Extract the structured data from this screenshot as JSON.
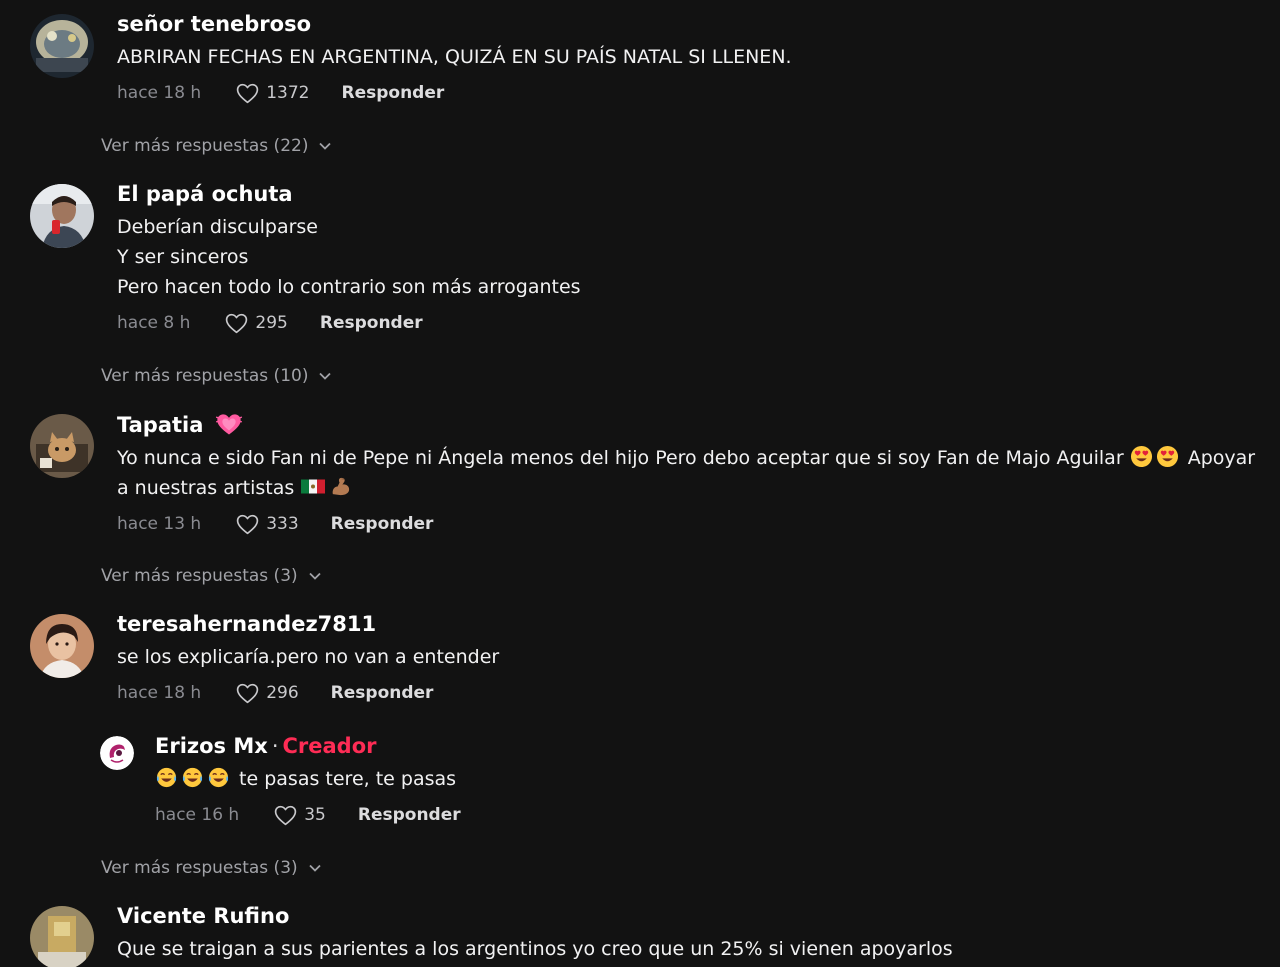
{
  "comments": [
    {
      "username": "señor tenebroso",
      "text": [
        "ABRIRAN FECHAS EN ARGENTINA, QUIZÁ EN SU PAÍS NATAL SI LLENEN."
      ],
      "time": "hace 18 h",
      "likes": "1372",
      "reply_label": "Responder",
      "more_replies": "Ver más respuestas (22)"
    },
    {
      "username": "El papá ochuta",
      "text": [
        "Deberían disculparse",
        "Y ser sinceros",
        "Pero hacen todo lo contrario son más arrogantes"
      ],
      "time": "hace 8 h",
      "likes": "295",
      "reply_label": "Responder",
      "more_replies": "Ver más respuestas (10)"
    },
    {
      "username": "Tapatia",
      "text_a": "Yo nunca e sido Fan ni de Pepe ni Ángela menos del hijo Pero debo aceptar que si soy Fan de Majo Aguilar",
      "text_b": "Apoyar",
      "text_c": "a nuestras artistas",
      "time": "hace 13 h",
      "likes": "333",
      "reply_label": "Responder",
      "more_replies": "Ver más respuestas (3)"
    },
    {
      "username": "teresahernandez7811",
      "text": [
        "se los explicaría.pero no van a entender"
      ],
      "time": "hace 18 h",
      "likes": "296",
      "reply_label": "Responder",
      "reply": {
        "username": "Erizos Mx",
        "separator": "·",
        "badge": "Creador",
        "text": "te pasas tere, te pasas",
        "time": "hace 16 h",
        "likes": "35",
        "reply_label": "Responder"
      },
      "more_replies": "Ver más respuestas (3)"
    },
    {
      "username": "Vicente Rufino",
      "text": [
        "Que se traigan a sus parientes a los argentinos yo creo que un 25% si vienen apoyarlos"
      ]
    }
  ],
  "icons": {
    "like": "heart-outline-icon",
    "expand": "chevron-down-icon",
    "emoji_heart": "beating-heart-emoji",
    "emoji_love": "heart-eyes-emoji",
    "emoji_flag": "mexico-flag-emoji",
    "emoji_arm": "flexed-biceps-emoji",
    "emoji_laugh": "tears-of-joy-emoji"
  },
  "colors": {
    "background": "#121212",
    "creator_badge": "#fe2c55",
    "muted": "#8a8b91"
  }
}
